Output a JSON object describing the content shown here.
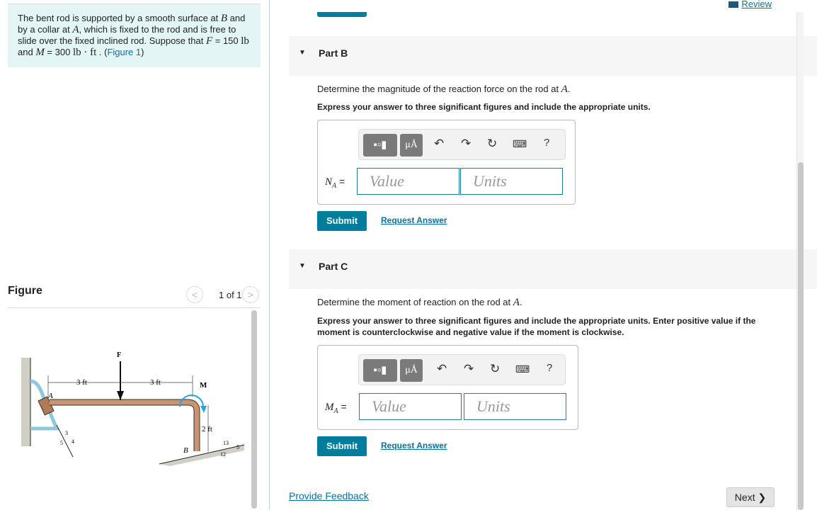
{
  "problem": {
    "text1": "The bent rod is supported by a smooth surface at ",
    "B": "B",
    "text2": " and by a collar at ",
    "A": "A",
    "text3": ", which is fixed to the rod and is free to slide over the fixed inclined rod. Suppose that ",
    "F": "F",
    "eq1": " = 150 ",
    "u1": "lb",
    "and": " and ",
    "M": "M",
    "eq2": " = 300 ",
    "u2": "lb · ft",
    "dot": " . (",
    "link": "Figure 1",
    ")": ")"
  },
  "figure": {
    "title": "Figure",
    "pager": "1 of 1",
    "labels": {
      "F": "F",
      "d1": "3 ft",
      "d2": "3 ft",
      "M": "M",
      "A": "A",
      "B": "B",
      "h": "2 ft",
      "s3": "3",
      "s4": "4",
      "s5": "5",
      "r13": "13",
      "r5": "5",
      "r12": "12"
    }
  },
  "header": {
    "review": "Review"
  },
  "partB": {
    "label": "Part B",
    "question": "Determine the magnitude of the reaction force on the rod at ",
    "var": "A",
    "q_end": ".",
    "instruction": "Express your answer to three significant figures and include the appropriate units.",
    "eq_label": "N",
    "eq_sub": "A",
    "eq_sign": " =",
    "value_placeholder": "Value",
    "units_placeholder": "Units",
    "submit": "Submit",
    "request": "Request Answer"
  },
  "partC": {
    "label": "Part C",
    "question": "Determine the moment of reaction on the rod at ",
    "var": "A",
    "q_end": ".",
    "instruction": "Express your answer to three significant figures and include the appropriate units. Enter positive value if the moment is counterclockwise and negative value if the moment is clockwise.",
    "eq_label": "M",
    "eq_sub": "A",
    "eq_sign": " =",
    "value_placeholder": "Value",
    "units_placeholder": "Units",
    "submit": "Submit",
    "request": "Request Answer"
  },
  "toolbar": {
    "units_btn": "μÅ",
    "help": "?"
  },
  "footer": {
    "feedback": "Provide Feedback",
    "next": "Next ❯"
  }
}
